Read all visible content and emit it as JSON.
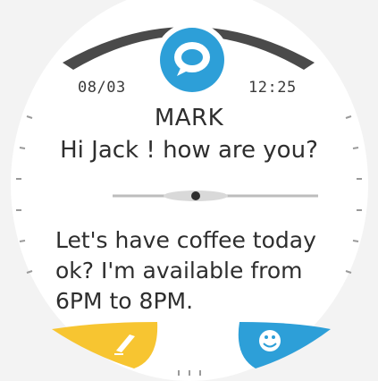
{
  "header": {
    "date": "08/03",
    "time": "12:25"
  },
  "message": {
    "sender": "MARK",
    "preview": "Hi Jack ! how are you?",
    "body": "Let's have coffee today\nok? I'm available from\n6PM to 8PM."
  },
  "icons": {
    "top": "chat-bubble-icon",
    "left": "pencil-icon",
    "right": "smiley-icon"
  },
  "colors": {
    "accent_blue": "#2d9fd8",
    "accent_yellow": "#f7c531",
    "bezel_dark": "#4a4a4a"
  },
  "scrollbar": {
    "position_fraction": 0.48
  }
}
